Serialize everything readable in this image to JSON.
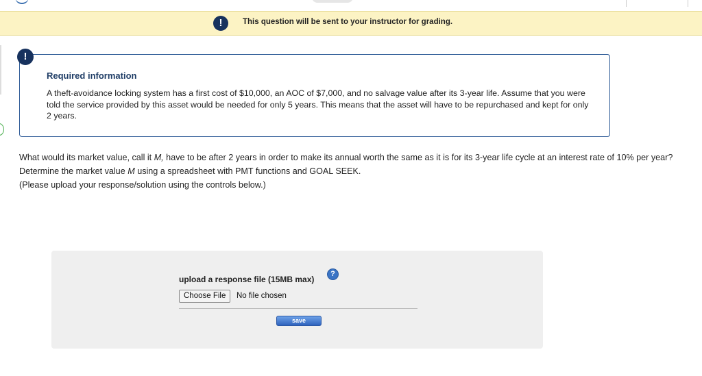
{
  "banner": {
    "icon": "exclamation-icon",
    "text": "This question will be sent to your instructor for grading."
  },
  "required_info": {
    "icon": "exclamation-icon",
    "heading": "Required information",
    "body": "A theft-avoidance locking system has a first cost of $10,000, an AOC of $7,000, and no salvage value after its 3-year life. Assume that you were told the service provided by this asset would be needed for only 5 years. This means that the asset will have to be repurchased and kept for only 2 years."
  },
  "question": {
    "part1": "What would its market value, call it ",
    "var1": "M,",
    "part2": " have to be after 2 years in order to make its annual worth the same as it is for its 3-year life cycle at an interest rate of 10% per year? Determine the market value ",
    "var2": "M",
    "part3": " using a spreadsheet with PMT functions and GOAL SEEK.",
    "line2": "(Please upload your response/solution using the controls below.)"
  },
  "upload": {
    "label": "upload a response file (15MB max)",
    "help_icon": "question-mark-icon",
    "choose_label": "Choose File",
    "file_status": "No file chosen",
    "save_label": "save"
  },
  "colors": {
    "banner_bg": "#fcf3c4",
    "icon_navy": "#17325e",
    "heading_blue": "#1f3d66",
    "box_border": "#2d5a96",
    "panel_bg": "#efefef",
    "save_blue": "#2f63bd"
  }
}
